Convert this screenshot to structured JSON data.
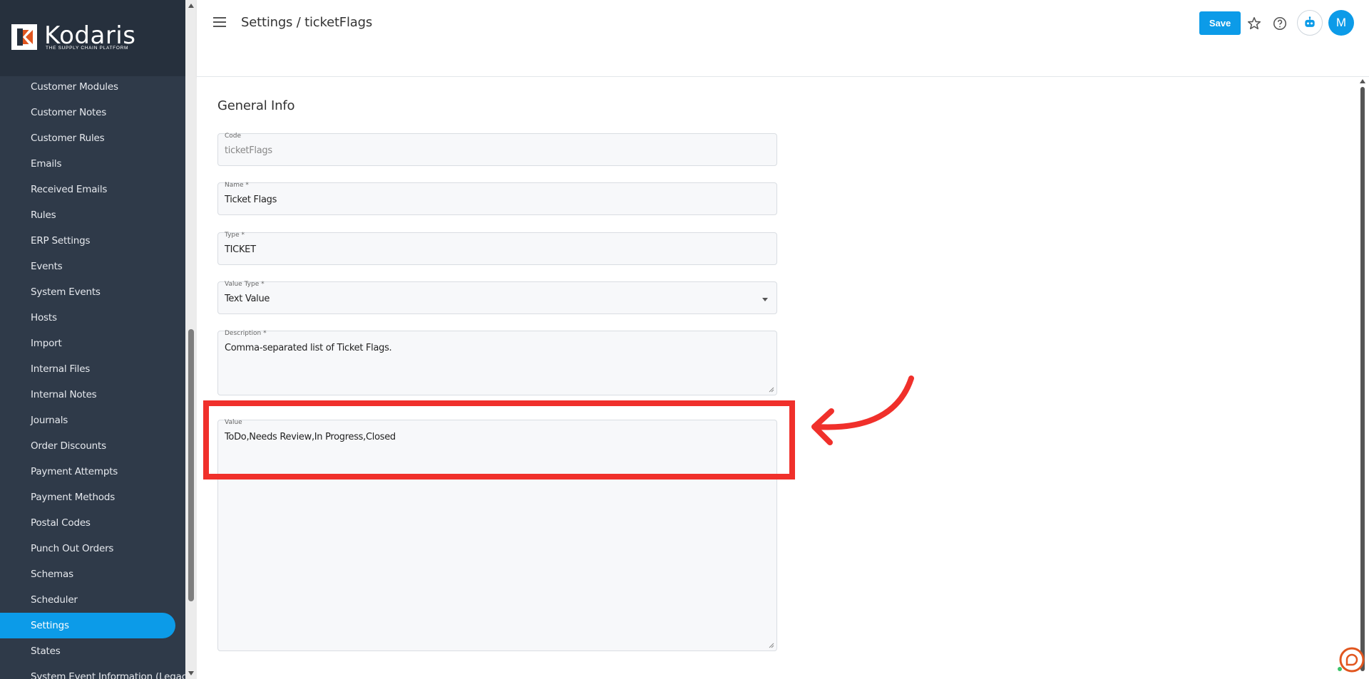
{
  "brand": {
    "name": "Kodaris",
    "tagline": "THE SUPPLY CHAIN PLATFORM"
  },
  "sidebar": {
    "items": [
      {
        "label": "Customer Modules"
      },
      {
        "label": "Customer Notes"
      },
      {
        "label": "Customer Rules"
      },
      {
        "label": "Emails"
      },
      {
        "label": "Received Emails"
      },
      {
        "label": "Rules"
      },
      {
        "label": "ERP Settings"
      },
      {
        "label": "Events"
      },
      {
        "label": "System Events"
      },
      {
        "label": "Hosts"
      },
      {
        "label": "Import"
      },
      {
        "label": "Internal Files"
      },
      {
        "label": "Internal Notes"
      },
      {
        "label": "Journals"
      },
      {
        "label": "Order Discounts"
      },
      {
        "label": "Payment Attempts"
      },
      {
        "label": "Payment Methods"
      },
      {
        "label": "Postal Codes"
      },
      {
        "label": "Punch Out Orders"
      },
      {
        "label": "Schemas"
      },
      {
        "label": "Scheduler"
      },
      {
        "label": "Settings",
        "active": true
      },
      {
        "label": "States"
      },
      {
        "label": "System Event Information (Legacy)"
      }
    ]
  },
  "header": {
    "breadcrumb": "Settings / ticketFlags",
    "save_label": "Save",
    "avatar_initial": "M"
  },
  "form": {
    "section_title": "General Info",
    "code": {
      "label": "Code",
      "value": "ticketFlags"
    },
    "name": {
      "label": "Name *",
      "value": "Ticket Flags"
    },
    "type": {
      "label": "Type *",
      "value": "TICKET"
    },
    "value_type": {
      "label": "Value Type *",
      "value": "Text Value"
    },
    "description": {
      "label": "Description *",
      "value": "Comma-separated list of Ticket Flags."
    },
    "value": {
      "label": "Value",
      "value": "ToDo,Needs Review,In Progress,Closed"
    }
  },
  "colors": {
    "accent": "#0c9be8",
    "sidebar": "#2f3a49",
    "annotation": "#f0302b"
  },
  "icons": [
    "menu-icon",
    "star-icon",
    "help-icon",
    "bot-icon",
    "chat-icon"
  ]
}
